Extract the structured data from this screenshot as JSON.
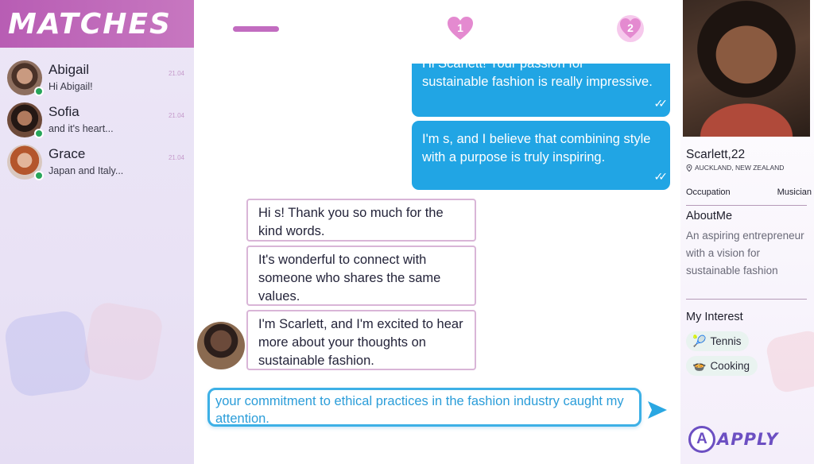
{
  "sidebar": {
    "title": "MATCHES",
    "matches": [
      {
        "name": "Abigail",
        "preview": "Hi Abigail!",
        "time": "21.04",
        "online": true
      },
      {
        "name": "Sofia",
        "preview": "and it's heart...",
        "time": "21.04",
        "online": true
      },
      {
        "name": "Grace",
        "preview": "Japan and Italy...",
        "time": "21.04",
        "online": true
      }
    ]
  },
  "topbar": {
    "heart_badges": [
      "1",
      "2"
    ]
  },
  "chat": {
    "messages": [
      {
        "from": "me",
        "text_cut": "Hi Scarlett! Your passion for",
        "text": "sustainable fashion is really impressive."
      },
      {
        "from": "me",
        "text": "I'm s, and I believe that combining style with a purpose is truly inspiring."
      },
      {
        "from": "them",
        "text": "Hi s! Thank you so much for the kind words."
      },
      {
        "from": "them",
        "text": "It's wonderful to connect with someone who shares the same values."
      },
      {
        "from": "them",
        "text": "I'm Scarlett, and I'm excited to hear more about your thoughts on sustainable fashion."
      }
    ],
    "composer_text": "your commitment to ethical practices in the fashion industry caught my attention."
  },
  "profile": {
    "name_age": "Scarlett,22",
    "location": "AUCKLAND, NEW ZEALAND",
    "occupation_label": "Occupation",
    "occupation_value": "Musician",
    "about_title": "AboutMe",
    "about_text": "An aspiring entrepreneur with a vision for sustainable fashion",
    "interest_title": "My Interest",
    "interests": [
      {
        "icon": "tennis-racket-icon",
        "label": "Tennis"
      },
      {
        "icon": "cooking-bowl-icon",
        "label": "Cooking"
      }
    ]
  },
  "brand": {
    "badge_letter": "A",
    "name": "APPLY"
  },
  "colors": {
    "accent_pink": "#c26cc0",
    "outgoing_bubble": "#21a5e4",
    "online": "#27a55a",
    "brand": "#6c4fc2"
  }
}
